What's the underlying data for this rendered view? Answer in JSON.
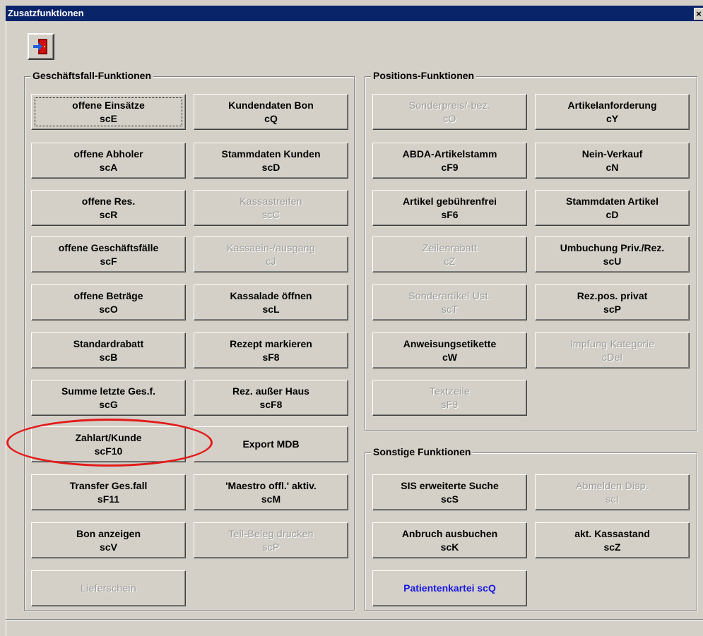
{
  "window": {
    "title": "Zusatzfunktionen",
    "close_label": "×"
  },
  "toolbar": {
    "exit_icon": "exit-door-icon"
  },
  "panels": {
    "geschaeftsfall": "Geschäftsfall-Funktionen",
    "positions": "Positions-Funktionen",
    "sonstige": "Sonstige Funktionen"
  },
  "buttons": {
    "offene_einsaetze": {
      "label": "offene Einsätze",
      "key": "scE"
    },
    "kundendaten_bon": {
      "label": "Kundendaten Bon",
      "key": "cQ"
    },
    "offene_abholer": {
      "label": "offene Abholer",
      "key": "scA"
    },
    "stammdaten_kunden": {
      "label": "Stammdaten Kunden",
      "key": "scD"
    },
    "offene_res": {
      "label": "offene Res.",
      "key": "scR"
    },
    "kassastreifen": {
      "label": "Kassastreifen",
      "key": "scC"
    },
    "offene_geschaeftsfaelle": {
      "label": "offene Geschäftsfälle",
      "key": "scF"
    },
    "kassaein_ausgang": {
      "label": "Kassaein-/ausgang",
      "key": "cJ"
    },
    "offene_betraege": {
      "label": "offene Beträge",
      "key": "scO"
    },
    "kassalade_oeffnen": {
      "label": "Kassalade öffnen",
      "key": "scL"
    },
    "standardrabatt": {
      "label": "Standardrabatt",
      "key": "scB"
    },
    "rezept_markieren": {
      "label": "Rezept markieren",
      "key": "sF8"
    },
    "summe_letzte": {
      "label": "Summe letzte Ges.f.",
      "key": "scG"
    },
    "rez_ausser_haus": {
      "label": "Rez. außer Haus",
      "key": "scF8"
    },
    "zahlart_kunde": {
      "label": "Zahlart/Kunde",
      "key": "scF10"
    },
    "export_mdb": {
      "label": "Export MDB"
    },
    "transfer_gesfall": {
      "label": "Transfer Ges.fall",
      "key": "sF11"
    },
    "maestro": {
      "label": "'Maestro offl.' aktiv.",
      "key": "scM"
    },
    "bon_anzeigen": {
      "label": "Bon anzeigen",
      "key": "scV"
    },
    "teil_beleg": {
      "label": "Teil-Beleg drucken",
      "key": "scP"
    },
    "lieferschein": {
      "label": "Lieferschein"
    },
    "sonderpreis": {
      "label": "Sonderpreis/-bez.",
      "key": "cO"
    },
    "artikelanforderung": {
      "label": "Artikelanforderung",
      "key": "cY"
    },
    "abda": {
      "label": "ABDA-Artikelstamm",
      "key": "cF9"
    },
    "nein_verkauf": {
      "label": "Nein-Verkauf",
      "key": "cN"
    },
    "artikel_gebuehrenfrei": {
      "label": "Artikel gebührenfrei",
      "key": "sF6"
    },
    "stammdaten_artikel": {
      "label": "Stammdaten Artikel",
      "key": "cD"
    },
    "zeilenrabatt": {
      "label": "Zeilenrabatt",
      "key": "cZ"
    },
    "umbuchung": {
      "label": "Umbuchung Priv./Rez.",
      "key": "scU"
    },
    "sonderartikel": {
      "label": "Sonderartikel Ust.",
      "key": "scT"
    },
    "rezpos_privat": {
      "label": "Rez.pos. privat",
      "key": "scP"
    },
    "anweisungsetikette": {
      "label": "Anweisungsetikette",
      "key": "cW"
    },
    "impfung": {
      "label": "Impfung Kategorie",
      "key": "cDel"
    },
    "textzeile": {
      "label": "Textzeile",
      "key": "sF9"
    },
    "sis_suche": {
      "label": "SIS erweiterte Suche",
      "key": "scS"
    },
    "abmelden_disp": {
      "label": "Abmelden Disp.",
      "key": "scI"
    },
    "anbruch": {
      "label": "Anbruch ausbuchen",
      "key": "scK"
    },
    "kassastand": {
      "label": "akt. Kassastand",
      "key": "scZ"
    },
    "patientenkartei": {
      "label": "Patientenkartei scQ"
    }
  },
  "colors": {
    "face": "#d4d0c8",
    "title_bar": "#0a246a",
    "disabled_text": "#9b9b9b",
    "link_text": "#1818e0",
    "annotation": "#e21b1b"
  }
}
